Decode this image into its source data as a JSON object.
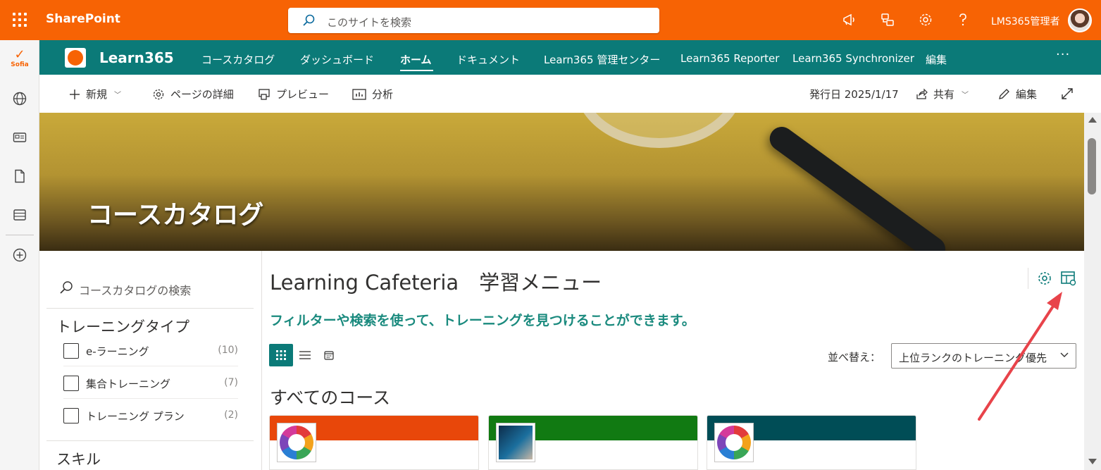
{
  "suite": {
    "brand": "SharePoint",
    "search_placeholder": "このサイトを検索",
    "user_name": "LMS365管理者",
    "colors": {
      "suite_bar": "#f76304"
    },
    "icons": [
      "megaphone-icon",
      "feedback-icon",
      "gear-icon",
      "help-icon"
    ]
  },
  "appbar": {
    "logo_label": "Sofia",
    "items": [
      "globe-icon",
      "news-icon",
      "document-icon",
      "list-icon",
      "add-circle-icon"
    ]
  },
  "hub": {
    "site_name": "Learn365",
    "nav": [
      {
        "label": "コースカタログ"
      },
      {
        "label": "ダッシュボード"
      },
      {
        "label": "ホーム",
        "active": true
      },
      {
        "label": "ドキュメント"
      },
      {
        "label": "Learn365 管理センター"
      },
      {
        "label": "Learn365 Reporter"
      },
      {
        "label": "Learn365 Synchronizer"
      },
      {
        "label": "編集"
      }
    ],
    "more": "···",
    "colors": {
      "hub_bar": "#0b7a78"
    }
  },
  "commandbar": {
    "new": "新規",
    "page_details": "ページの詳細",
    "preview": "プレビュー",
    "analytics": "分析",
    "published": "発行日 2025/1/17",
    "share": "共有",
    "edit": "編集"
  },
  "banner": {
    "title": "コースカタログ"
  },
  "filter": {
    "search_placeholder": "コースカタログの検索",
    "training_type_title": "トレーニングタイプ",
    "training_types": [
      {
        "label": "e-ラーニング",
        "count": "(10)"
      },
      {
        "label": "集合トレーニング",
        "count": "(7)"
      },
      {
        "label": "トレーニング プラン",
        "count": "(2)"
      }
    ],
    "skill_title": "スキル"
  },
  "main": {
    "title": "Learning Cafeteria　学習メニュー",
    "subtitle": "フィルターや検索を使って、トレーニングを見つけることができます。",
    "sort_label": "並べ替え：",
    "sort_value": "上位ランクのトレーニング優先",
    "section_title": "すべてのコース",
    "cards": [
      {
        "band_color": "#e8470a"
      },
      {
        "band_color": "#117a12"
      },
      {
        "band_color": "#004d56"
      }
    ],
    "colors": {
      "accent": "#1a8a7e",
      "annotation_arrow": "#e8434a"
    }
  }
}
